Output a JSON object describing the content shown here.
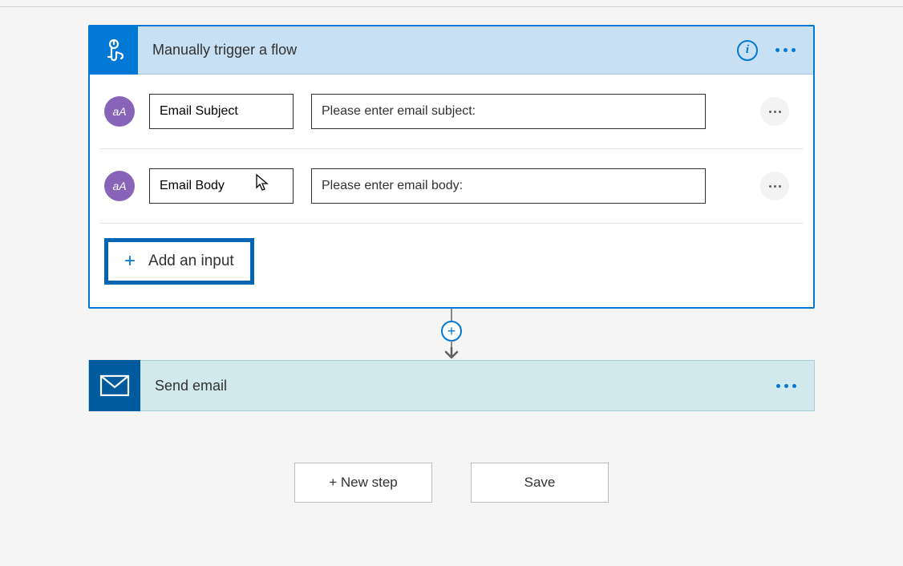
{
  "trigger": {
    "title": "Manually trigger a flow",
    "inputs": [
      {
        "name": "Email Subject",
        "description": "Please enter email subject:",
        "icon_label": "aA"
      },
      {
        "name": "Email Body",
        "description": "Please enter email body:",
        "icon_label": "aA"
      }
    ],
    "add_input_label": "Add an input"
  },
  "action": {
    "title": "Send email"
  },
  "buttons": {
    "new_step": "+ New step",
    "save": "Save"
  }
}
